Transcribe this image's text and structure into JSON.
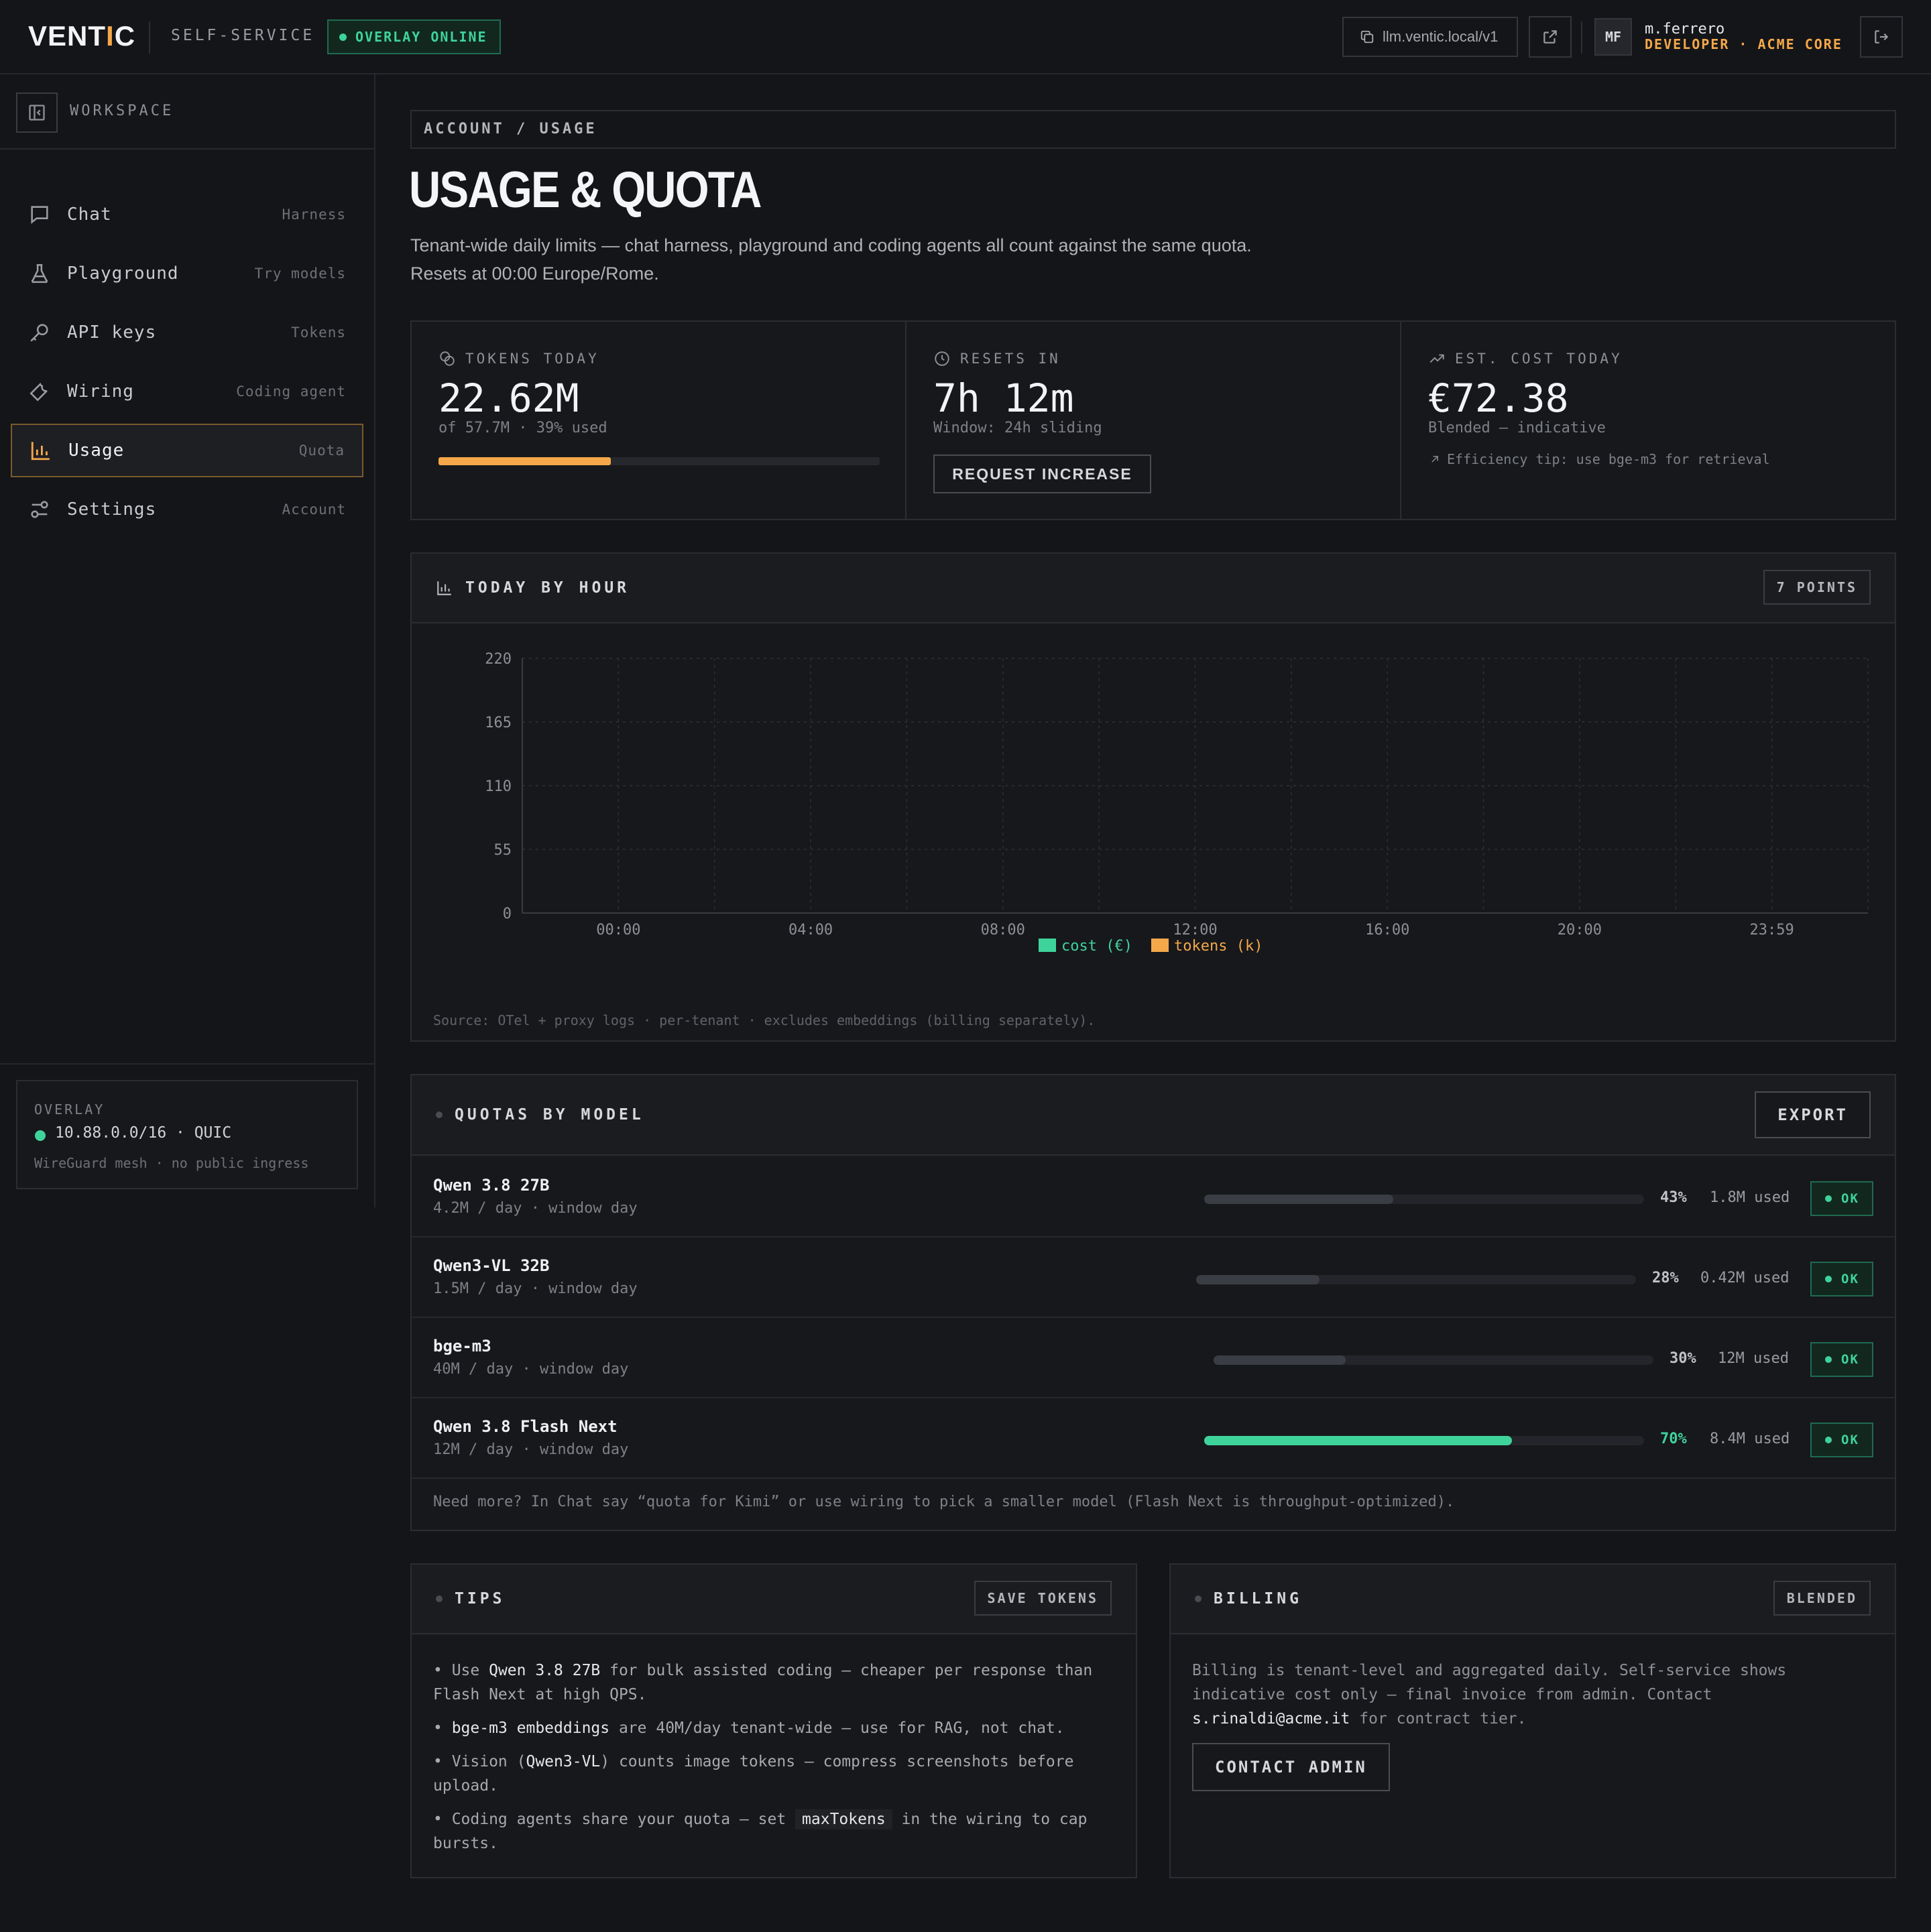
{
  "header": {
    "logo_prefix": "VENT",
    "logo_accent": "I",
    "logo_suffix": "C",
    "section": "SELF-SERVICE",
    "overlay_status": "OVERLAY ONLINE",
    "endpoint": "llm.ventic.local/v1",
    "avatar_initials": "MF",
    "username": "m.ferrero",
    "role": "DEVELOPER · ACME CORE"
  },
  "sidebar": {
    "title": "WORKSPACE",
    "items": [
      {
        "label": "Chat",
        "hint": "Harness",
        "icon": "chat-icon"
      },
      {
        "label": "Playground",
        "hint": "Try models",
        "icon": "flask-icon"
      },
      {
        "label": "API keys",
        "hint": "Tokens",
        "icon": "key-icon"
      },
      {
        "label": "Wiring",
        "hint": "Coding agent",
        "icon": "wrench-icon"
      },
      {
        "label": "Usage",
        "hint": "Quota",
        "icon": "bar-chart-icon",
        "active": true
      },
      {
        "label": "Settings",
        "hint": "Account",
        "icon": "sliders-icon"
      }
    ],
    "overlay": {
      "label": "OVERLAY",
      "network": "10.88.0.0/16 · QUIC",
      "sub": "WireGuard mesh · no public ingress"
    }
  },
  "main": {
    "breadcrumb": "ACCOUNT / USAGE",
    "title": "USAGE & QUOTA",
    "description": "Tenant-wide daily limits — chat harness, playground and coding agents all count against the same quota. Resets at 00:00 Europe/Rome.",
    "stats": {
      "tokens": {
        "label": "TOKENS TODAY",
        "value": "22.62M",
        "sub": "of 57.7M · 39% used",
        "progress": 0.39
      },
      "resets": {
        "label": "RESETS IN",
        "value": "7h 12m",
        "sub": "Window: 24h sliding",
        "button": "REQUEST INCREASE"
      },
      "cost": {
        "label": "EST. COST TODAY",
        "value": "€72.38",
        "sub": "Blended — indicative",
        "tip": "Efficiency tip: use bge-m3 for retrieval"
      }
    }
  },
  "chart_panel": {
    "title": "TODAY BY HOUR",
    "badge": "7 POINTS",
    "source": "Source: OTel + proxy logs · per-tenant · excludes embeddings (billing separately)."
  },
  "chart_data": {
    "type": "bar",
    "categories": [
      "00:00",
      "04:00",
      "08:00",
      "12:00",
      "16:00",
      "20:00",
      "23:59"
    ],
    "series": [
      {
        "name": "cost (€)",
        "values": [
          0,
          0,
          0,
          0,
          0,
          0,
          0
        ],
        "color": "#3fd39c"
      },
      {
        "name": "tokens (k)",
        "values": [
          0,
          0,
          0,
          0,
          0,
          0,
          0
        ],
        "color": "#f5a84a"
      }
    ],
    "yticks": [
      "0",
      "55",
      "110",
      "165",
      "220"
    ],
    "ylim": [
      0,
      220
    ],
    "grid": true,
    "legend": "bottom-center"
  },
  "quotas": {
    "title": "QUOTAS BY MODEL",
    "export": "EXPORT",
    "rows": [
      {
        "name": "Qwen 3.8 27B",
        "meta": "4.2M / day · window day",
        "pct": "43%",
        "fraction": 0.43,
        "used": "1.8M used",
        "status": "OK"
      },
      {
        "name": "Qwen3-VL 32B",
        "meta": "1.5M / day · window day",
        "pct": "28%",
        "fraction": 0.28,
        "used": "0.42M used",
        "status": "OK"
      },
      {
        "name": "bge-m3",
        "meta": "40M / day · window day",
        "pct": "30%",
        "fraction": 0.3,
        "used": "12M used",
        "status": "OK"
      },
      {
        "name": "Qwen 3.8 Flash Next",
        "meta": "12M / day · window day",
        "pct": "70%",
        "fraction": 0.7,
        "used": "8.4M used",
        "status": "OK"
      }
    ],
    "footer": "Need more? In Chat say “quota for Kimi” or use wiring to pick a smaller model (Flash Next is throughput-optimized)."
  },
  "tips": {
    "title": "TIPS",
    "badge": "SAVE TOKENS",
    "t1_pre": "• Use ",
    "t1_hl": "Qwen 3.8 27B",
    "t1_post": " for bulk assisted coding — cheaper per response than Flash Next at high QPS.",
    "t2_pre": "• ",
    "t2_hl": "bge-m3 embeddings",
    "t2_post": " are 40M/day tenant-wide — use for RAG, not chat.",
    "t3_pre": "• Vision (",
    "t3_hl": "Qwen3-VL",
    "t3_post": ") counts image tokens — compress screenshots before upload.",
    "t4_pre": "• Coding agents share your quota — set ",
    "t4_code": "maxTokens",
    "t4_post": " in the wiring to cap bursts."
  },
  "billing": {
    "title": "BILLING",
    "badge": "BLENDED",
    "text_pre": "Billing is tenant-level and aggregated daily. Self-service shows indicative cost only — final invoice from admin. Contact ",
    "email": "s.rinaldi@acme.it",
    "text_post": " for contract tier.",
    "button": "CONTACT ADMIN"
  }
}
